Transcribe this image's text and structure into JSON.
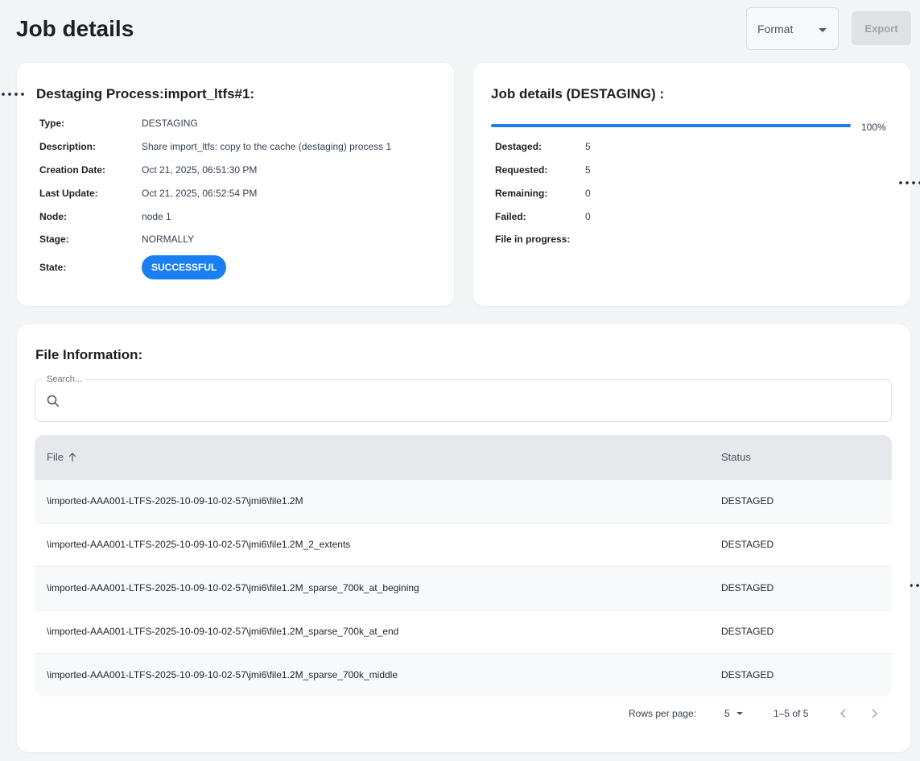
{
  "header": {
    "title": "Job details",
    "format_label": "Format",
    "export_label": "Export"
  },
  "process": {
    "heading": "Destaging Process:import_ltfs#1:",
    "fields": [
      {
        "label": "Type:",
        "value": "DESTAGING"
      },
      {
        "label": "Description:",
        "value": "Share import_ltfs: copy to the cache (destaging) process 1"
      },
      {
        "label": "Creation Date:",
        "value": "Oct 21, 2025, 06:51:30 PM"
      },
      {
        "label": "Last Update:",
        "value": "Oct 21, 2025, 06:52:54 PM"
      },
      {
        "label": "Node:",
        "value": "node 1"
      },
      {
        "label": "Stage:",
        "value": "NORMALLY"
      },
      {
        "label": "State:",
        "value": "SUCCESSFUL"
      }
    ]
  },
  "progress": {
    "heading": "Job details (DESTAGING) :",
    "percent_label": "100%",
    "fraction": 1.0,
    "fields": [
      {
        "label": "Destaged:",
        "value": "5"
      },
      {
        "label": "Requested:",
        "value": "5"
      },
      {
        "label": "Remaining:",
        "value": "0"
      },
      {
        "label": "Failed:",
        "value": "0"
      },
      {
        "label": "File in progress:",
        "value": ""
      }
    ]
  },
  "files": {
    "heading": "File Information:",
    "search_label": "Search...",
    "columns": {
      "file": "File",
      "status": "Status"
    },
    "rows": [
      {
        "file": "\\imported-AAA001-LTFS-2025-10-09-10-02-57\\jmi6\\file1.2M",
        "status": "DESTAGED"
      },
      {
        "file": "\\imported-AAA001-LTFS-2025-10-09-10-02-57\\jmi6\\file1.2M_2_extents",
        "status": "DESTAGED"
      },
      {
        "file": "\\imported-AAA001-LTFS-2025-10-09-10-02-57\\jmi6\\file1.2M_sparse_700k_at_begining",
        "status": "DESTAGED"
      },
      {
        "file": "\\imported-AAA001-LTFS-2025-10-09-10-02-57\\jmi6\\file1.2M_sparse_700k_at_end",
        "status": "DESTAGED"
      },
      {
        "file": "\\imported-AAA001-LTFS-2025-10-09-10-02-57\\jmi6\\file1.2M_sparse_700k_middle",
        "status": "DESTAGED"
      }
    ],
    "pagination": {
      "rows_per_page_label": "Rows per page:",
      "rows_per_page_value": "5",
      "range_label": "1–5 of 5",
      "prev_icon": "chevron-left-icon",
      "next_icon": "chevron-right-icon"
    }
  },
  "colors": {
    "accent": "#1a7ff1",
    "background": "#f3f4f6",
    "card": "#ffffff"
  }
}
